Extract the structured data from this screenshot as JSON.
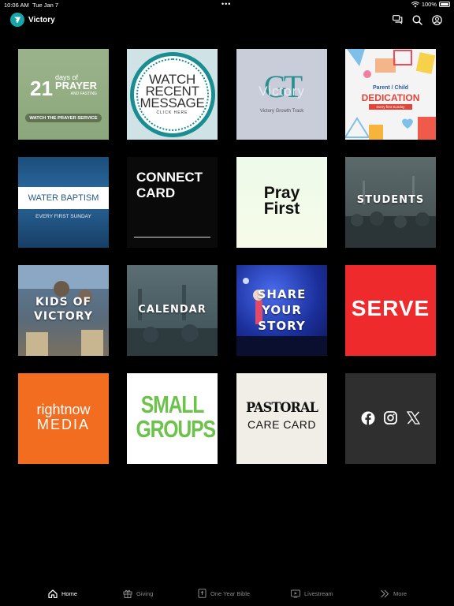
{
  "status": {
    "time": "10:06 AM",
    "date": "Tue Jan 7",
    "more": "•••",
    "battery": "100%"
  },
  "app": {
    "title": "Victory"
  },
  "tiles": {
    "prayer": {
      "big": "21",
      "days_of": "days of",
      "prayer": "PRAYER",
      "fasting": "AND FASTING",
      "pill": "WATCH THE PRAYER SERVICE"
    },
    "watch": {
      "l1": "WATCH",
      "l2": "RECENT",
      "l3": "MESSAGE",
      "l4": "CLICK HERE"
    },
    "growth": {
      "mono": "GT",
      "word": "Victory",
      "caption": "Victory Growth Track"
    },
    "dedication": {
      "l1": "Parent / Child",
      "l2": "DEDICATION",
      "l3": "every first Sunday"
    },
    "water": {
      "title": "WATER BAPTISM",
      "sub": "EVERY FIRST SUNDAY"
    },
    "connect": {
      "l1": "CONNECT",
      "l2": "CARD"
    },
    "pray": {
      "l1": "Pray",
      "l2": "First"
    },
    "students": {
      "label": "STUDENTS"
    },
    "kids": {
      "l1": "KIDS OF",
      "l2": "VICTORY"
    },
    "calendar": {
      "label": "CALENDAR"
    },
    "share": {
      "l1": "SHARE",
      "l2": "YOUR",
      "l3": "STORY"
    },
    "serve": {
      "label": "SERVE"
    },
    "rightnow": {
      "l1": "rightnow",
      "l2": "MEDIA"
    },
    "small": {
      "l1": "SMALL",
      "l2": "GROUPS"
    },
    "pastoral": {
      "l1": "PASTORAL",
      "l2": "CARE CARD"
    },
    "social": {
      "icons": [
        "facebook-icon",
        "instagram-icon",
        "x-icon"
      ]
    }
  },
  "nav": {
    "home": "Home",
    "giving": "Giving",
    "bible": "One Year Bible",
    "livestream": "Livestream",
    "more": "More"
  },
  "colors": {
    "accent": "#17a6a8",
    "serve_red": "#ee2a2c",
    "rightnow_orange": "#f26d1f",
    "small_groups_green": "#6cc24a"
  }
}
